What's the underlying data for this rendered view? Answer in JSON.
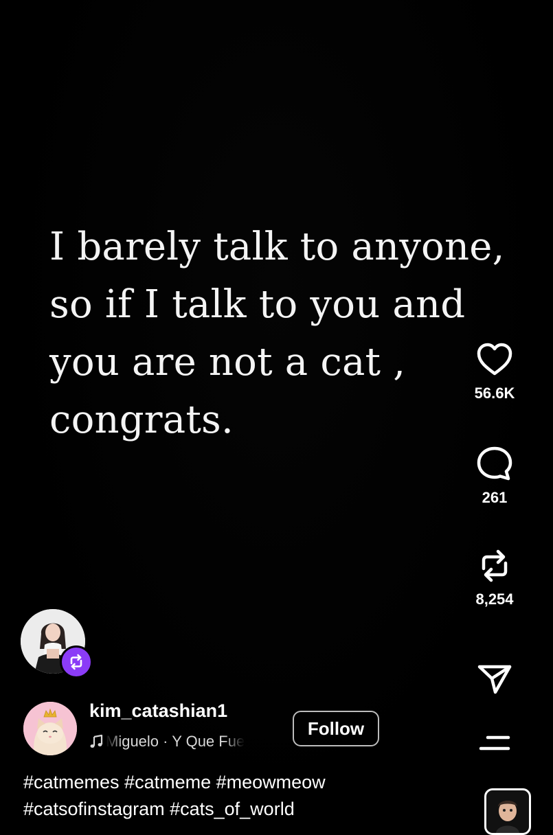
{
  "post": {
    "caption_lines": [
      "I barely talk to anyone,",
      "so if I talk to you and",
      "you are not a cat ,",
      "congrats."
    ]
  },
  "actions": {
    "like_count": "56.6K",
    "comment_count": "261",
    "repost_count": "8,254"
  },
  "author": {
    "username": "kim_catashian1",
    "music": "Miguelo · Y Que Fue"
  },
  "follow_button": {
    "label": "Follow"
  },
  "hashtags": {
    "line1": "#catmemes #catmeme #meowmeow",
    "line2": "#catsofinstagram #cats_of_world"
  },
  "icons": {
    "like": "heart-icon",
    "comment": "comment-bubble-icon",
    "repost": "repost-icon",
    "share": "send-icon",
    "more": "menu-icon",
    "music": "music-note-icon",
    "repost_badge": "repost-badge-icon"
  },
  "colors": {
    "background": "#000000",
    "repost_badge": "#8b3cf7",
    "text": "#ffffff"
  }
}
